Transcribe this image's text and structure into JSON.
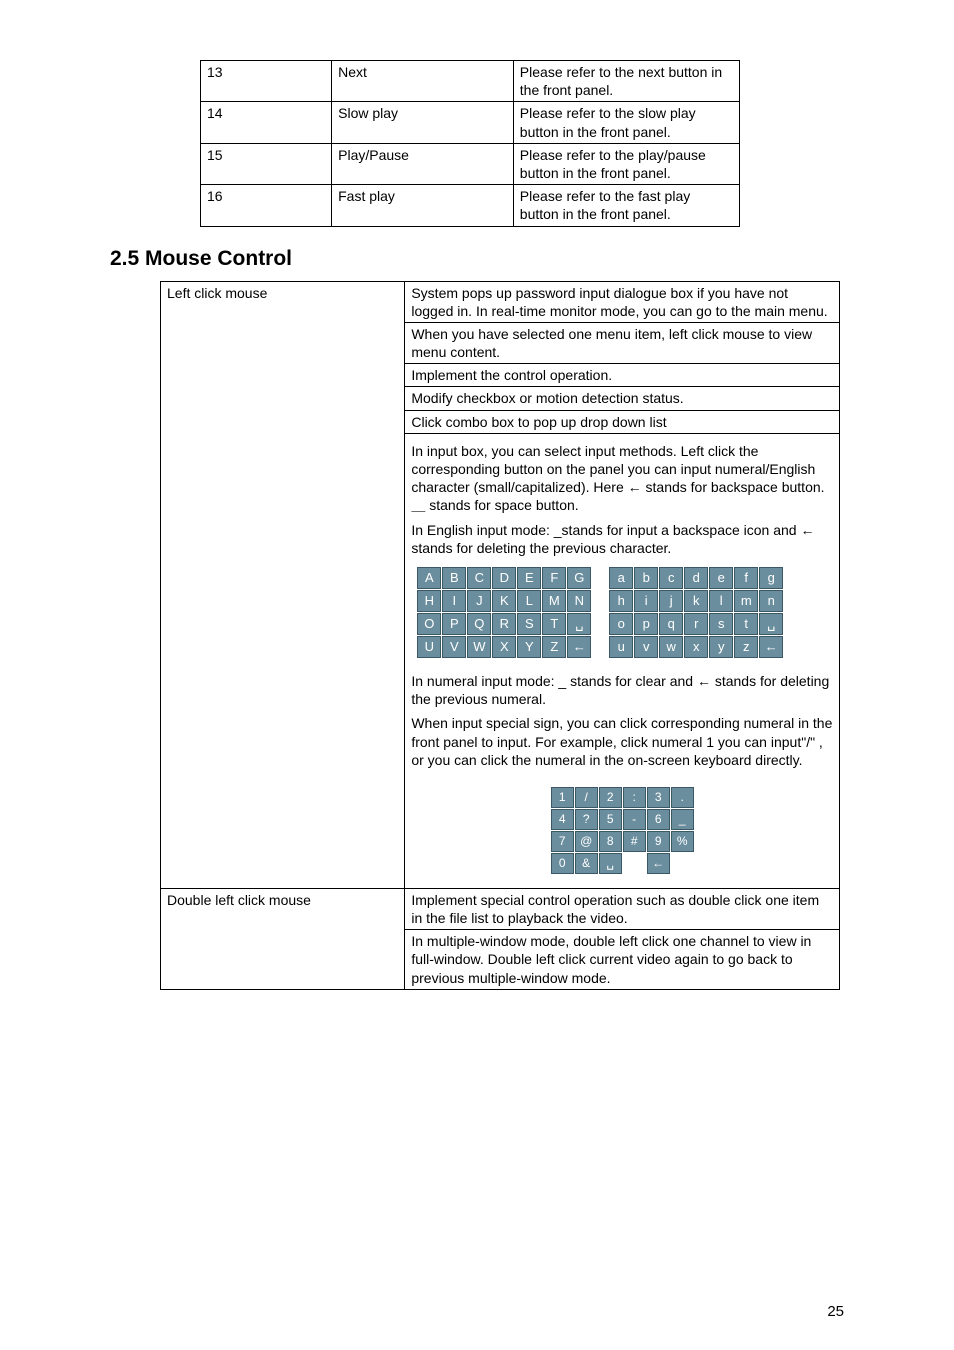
{
  "first_table": {
    "rows": [
      {
        "n": "13",
        "name": "Next",
        "desc": "Please refer to the next button in the front panel."
      },
      {
        "n": "14",
        "name": "Slow play",
        "desc": "Please refer to the slow play button in the front panel."
      },
      {
        "n": "15",
        "name": "Play/Pause",
        "desc": "Please refer to the play/pause button in the front panel."
      },
      {
        "n": "16",
        "name": "Fast play",
        "desc": "Please refer to the fast play button in the front panel."
      }
    ]
  },
  "heading": "2.5  Mouse Control",
  "mouse_table": {
    "rows_left_click": {
      "label": "Left click mouse",
      "cells": [
        "System pops up password input dialogue box if you have not logged in. In real-time monitor mode, you can go to the main menu.",
        "When you have selected one menu item, left click mouse to view menu content.",
        "Implement the control operation.",
        "Modify checkbox or motion detection status.",
        "Click combo box to pop up drop down list"
      ],
      "input_intro_1": "In input box, you can select input methods. Left click the corresponding button on the panel you can input numeral/English character (small/capitalized). Here ← stands for backspace button. ＿ stands for space button.",
      "input_intro_2": "In English input mode: _stands for input a backspace icon and ← stands for deleting the previous character.",
      "kb_upper": [
        "A",
        "B",
        "C",
        "D",
        "E",
        "F",
        "G",
        "H",
        "I",
        "J",
        "K",
        "L",
        "M",
        "N",
        "O",
        "P",
        "Q",
        "R",
        "S",
        "T",
        "␣",
        "U",
        "V",
        "W",
        "X",
        "Y",
        "Z",
        "←"
      ],
      "kb_lower": [
        "a",
        "b",
        "c",
        "d",
        "e",
        "f",
        "g",
        "h",
        "i",
        "j",
        "k",
        "l",
        "m",
        "n",
        "o",
        "p",
        "q",
        "r",
        "s",
        "t",
        "␣",
        "u",
        "v",
        "w",
        "x",
        "y",
        "z",
        "←"
      ],
      "num_intro": "In numeral input mode:  _ stands for clear and  ← stands for deleting the previous numeral.",
      "special_intro": "When input special sign, you can click corresponding numeral in the front panel to input. For example, click numeral 1 you can input\"/\" , or you can click the numeral in the  on-screen keyboard directly.",
      "num_grid": [
        "1",
        "/",
        "2",
        ":",
        "3",
        ".",
        "4",
        "?",
        "5",
        "-",
        "6",
        "_",
        "7",
        "@",
        "8",
        "#",
        "9",
        "%",
        "0",
        "&",
        "␣",
        "",
        "←",
        ""
      ]
    },
    "rows_double": {
      "label": "Double left click mouse",
      "cells": [
        "Implement special control operation such as double click one item in the file list to playback the video.",
        "In multiple-window mode, double left click one channel to view in full-window. Double left click current video again to go back to previous multiple-window mode."
      ]
    }
  },
  "page_number": "25"
}
